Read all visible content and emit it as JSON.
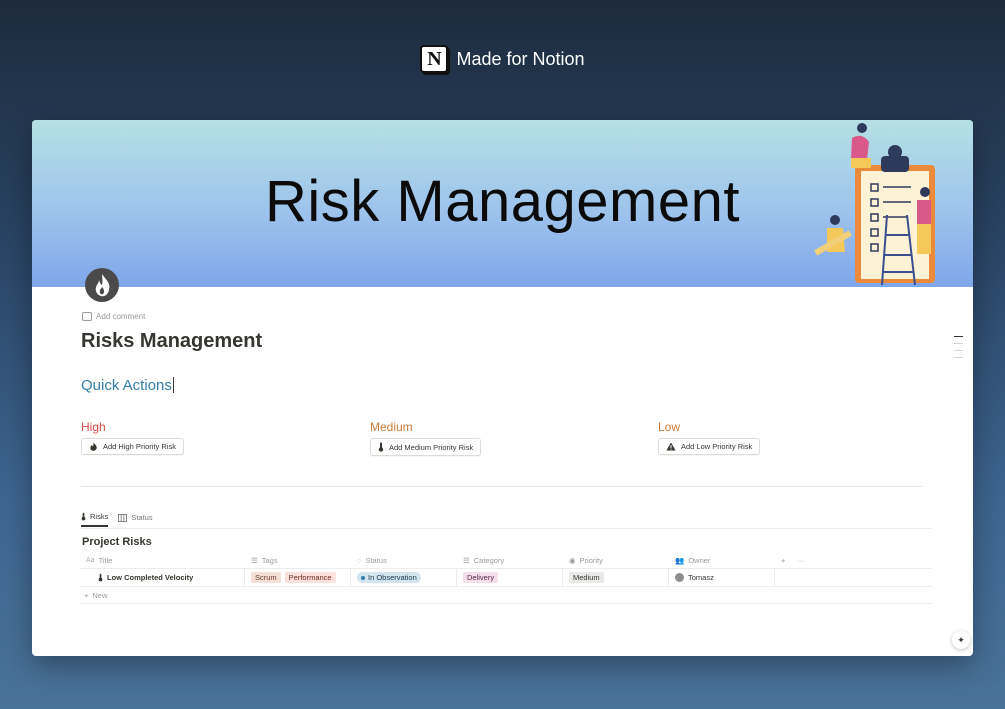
{
  "brand": {
    "text": "Made for Notion",
    "logo_letter": "N"
  },
  "cover": {
    "title": "Risk Management"
  },
  "page": {
    "add_comment": "Add comment",
    "title": "Risks Management",
    "quick_actions": "Quick Actions"
  },
  "actions": {
    "high": {
      "heading": "High",
      "button": "Add High Priority Risk",
      "color": "#d44c47"
    },
    "medium": {
      "heading": "Medium",
      "button": "Add Medium Priority Risk",
      "color": "#cb7b37"
    },
    "low": {
      "heading": "Low",
      "button": "Add Low Priority Risk",
      "color": "#cb7b37"
    }
  },
  "tabs": [
    {
      "label": "Risks",
      "icon": "thermometer-icon"
    },
    {
      "label": "Status",
      "icon": "board-icon"
    }
  ],
  "database": {
    "title": "Project Risks",
    "columns": {
      "title": "Title",
      "tags": "Tags",
      "status": "Status",
      "category": "Category",
      "priority": "Priority",
      "owner": "Owner"
    },
    "rows": [
      {
        "title": "Low Completed Velocity",
        "tags": [
          "Scrum",
          "Performance"
        ],
        "status": "In Observation",
        "category": "Delivery",
        "priority": "Medium",
        "owner": "Tomasz"
      }
    ],
    "new_label": "New"
  },
  "colors": {
    "accent": "#337ea9",
    "tag_scrum": "#f4e0d7",
    "tag_performance": "#fbe1dc",
    "status_bg": "#d3e5ef",
    "category_bg": "#f4dfeb",
    "priority_bg": "#e9e9e7"
  }
}
